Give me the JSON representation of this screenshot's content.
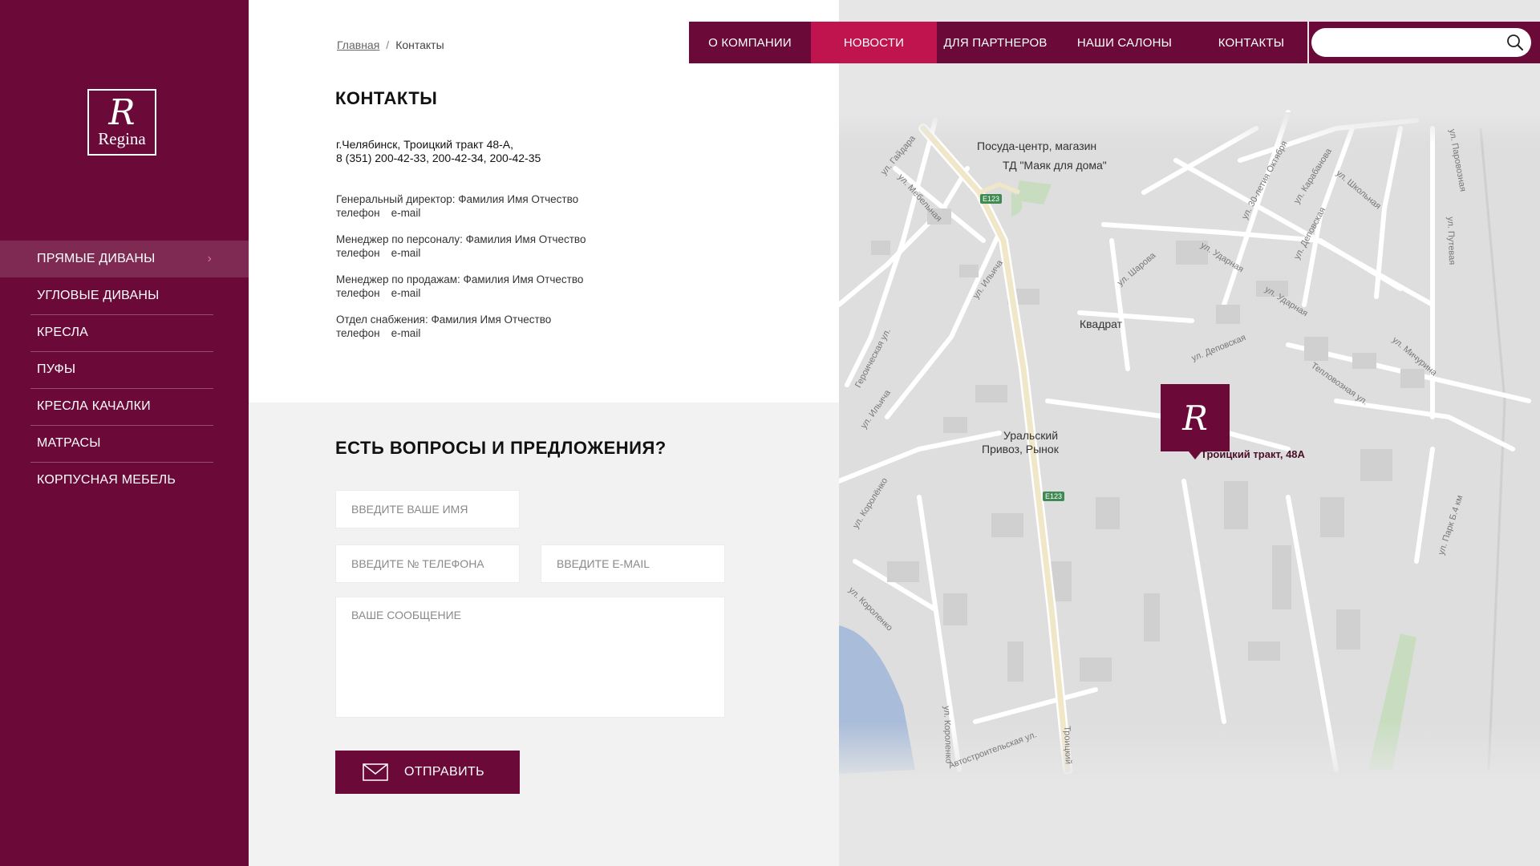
{
  "sidebar": {
    "logo": {
      "monogram": "R",
      "brand": "Regina"
    },
    "items": [
      {
        "label": "ПРЯМЫЕ ДИВАНЫ",
        "active": true
      },
      {
        "label": "УГЛОВЫЕ ДИВАНЫ"
      },
      {
        "label": "КРЕСЛА"
      },
      {
        "label": "ПУФЫ"
      },
      {
        "label": "КРЕСЛА КАЧАЛКИ"
      },
      {
        "label": "МАТРАСЫ"
      },
      {
        "label": "КОРПУСНАЯ МЕБЕЛЬ"
      }
    ]
  },
  "topnav": {
    "items": [
      {
        "label": "О КОМПАНИИ"
      },
      {
        "label": "НОВОСТИ",
        "active": true
      },
      {
        "label": "ДЛЯ ПАРТНЕРОВ"
      },
      {
        "label": "НАШИ САЛОНЫ"
      },
      {
        "label": "КОНТАКТЫ"
      }
    ],
    "search_placeholder": ""
  },
  "breadcrumb": {
    "home": "Главная",
    "separator": "/",
    "current": "Контакты"
  },
  "page": {
    "title": "КОНТАКТЫ",
    "address_line1": "г.Челябинск, Троицкий тракт 48-А,",
    "address_line2": "8 (351) 200-42-33, 200-42-34, 200-42-35"
  },
  "contacts": [
    {
      "role": "Генеральный директор: Фамилия Имя Отчество",
      "phone": "телефон",
      "email": "e-mail"
    },
    {
      "role": "Менеджер по персоналу: Фамилия Имя Отчество",
      "phone": "телефон",
      "email": "e-mail"
    },
    {
      "role": "Менеджер по продажам: Фамилия Имя Отчество",
      "phone": "телефон",
      "email": "e-mail"
    },
    {
      "role": "Отдел снабжения: Фамилия Имя Отчество",
      "phone": "телефон",
      "email": "e-mail"
    }
  ],
  "form": {
    "title": "ЕСТЬ ВОПРОСЫ И ПРЕДЛОЖЕНИЯ?",
    "name_placeholder": "ВВЕДИТЕ ВАШЕ ИМЯ",
    "phone_placeholder": "ВВЕДИТЕ № ТЕЛЕФОНА",
    "email_placeholder": "ВВЕДИТЕ E-MAIL",
    "message_placeholder": "ВАШЕ СООБЩЕНИЕ",
    "submit_label": "ОТПРАВИТЬ"
  },
  "map": {
    "pois": [
      {
        "name": "Посуда-центр, магазин"
      },
      {
        "name": "ТД \"Маяк для дома\""
      },
      {
        "name": "Квадрат"
      },
      {
        "name": "Уральский"
      },
      {
        "name": "Привоз, Рынок"
      }
    ],
    "road_badges": [
      "E123",
      "E123"
    ],
    "streets": [
      "ул. Гайдара",
      "ул. Мебельная",
      "ул. Ильича",
      "Героическая ул.",
      "ул. Ильича",
      "ул. Шарова",
      "ул. 30-летия Октября",
      "ул. Карабанова",
      "ул. Школьная",
      "ул. Деповская",
      "ул. Ударная",
      "ул. Ударная",
      "ул. Паровозная",
      "ул. Путевая",
      "ул. Мичурина",
      "Тепловозная ул.",
      "ул. Деповская",
      "ул. Королёнко",
      "ул. Короленко",
      "ул. Короленко",
      "ул. Парк Б.4 км",
      "Автостроительская ул.",
      "Троицкий"
    ],
    "marker_label": "Троицкий тракт, 48А",
    "colors": {
      "brand": "#6b0a39",
      "accent": "#c0144e",
      "water": "#a9bcd9",
      "park": "#c8ddc0"
    }
  }
}
